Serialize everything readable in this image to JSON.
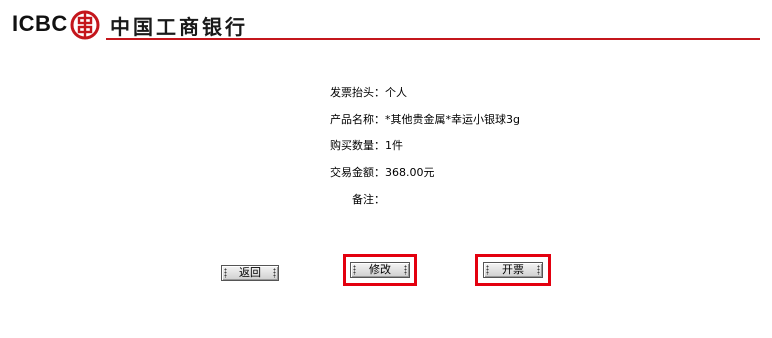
{
  "header": {
    "logo_text": "ICBC",
    "bank_name": "中国工商银行",
    "seal_icon": "icbc-seal-icon",
    "brand_color": "#c4161c"
  },
  "invoice": {
    "title_label": "发票抬头：",
    "title_value": "个人",
    "product_label": "产品名称：",
    "product_value": "*其他贵金属*幸运小银球3g",
    "qty_label": "购买数量：",
    "qty_value": "1件",
    "amount_label": "交易金额：",
    "amount_value": "368.00元",
    "note_label": "备注："
  },
  "buttons": {
    "back_label": "返回",
    "modify_label": "修改",
    "issue_label": "开票"
  },
  "highlight_color": "#e3000f"
}
